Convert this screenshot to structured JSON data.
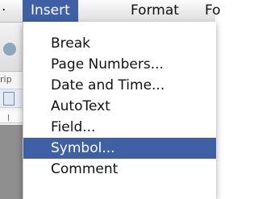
{
  "menubar": {
    "partial_left": "·",
    "items": [
      {
        "label": "Insert",
        "active": true
      },
      {
        "label": "Format",
        "active": false
      },
      {
        "label": "Fo",
        "active": false
      }
    ]
  },
  "background": {
    "ruler_fragment": "rip"
  },
  "insert_menu": {
    "items": [
      {
        "label": "Break",
        "selected": false
      },
      {
        "label": "Page Numbers...",
        "selected": false
      },
      {
        "label": "Date and Time...",
        "selected": false
      },
      {
        "label": "AutoText",
        "selected": false
      },
      {
        "label": "Field...",
        "selected": false
      },
      {
        "label": "Symbol...",
        "selected": true
      },
      {
        "label": "Comment",
        "selected": false
      }
    ]
  },
  "colors": {
    "highlight": "#3f60a5",
    "highlight_text": "#ffffff"
  }
}
